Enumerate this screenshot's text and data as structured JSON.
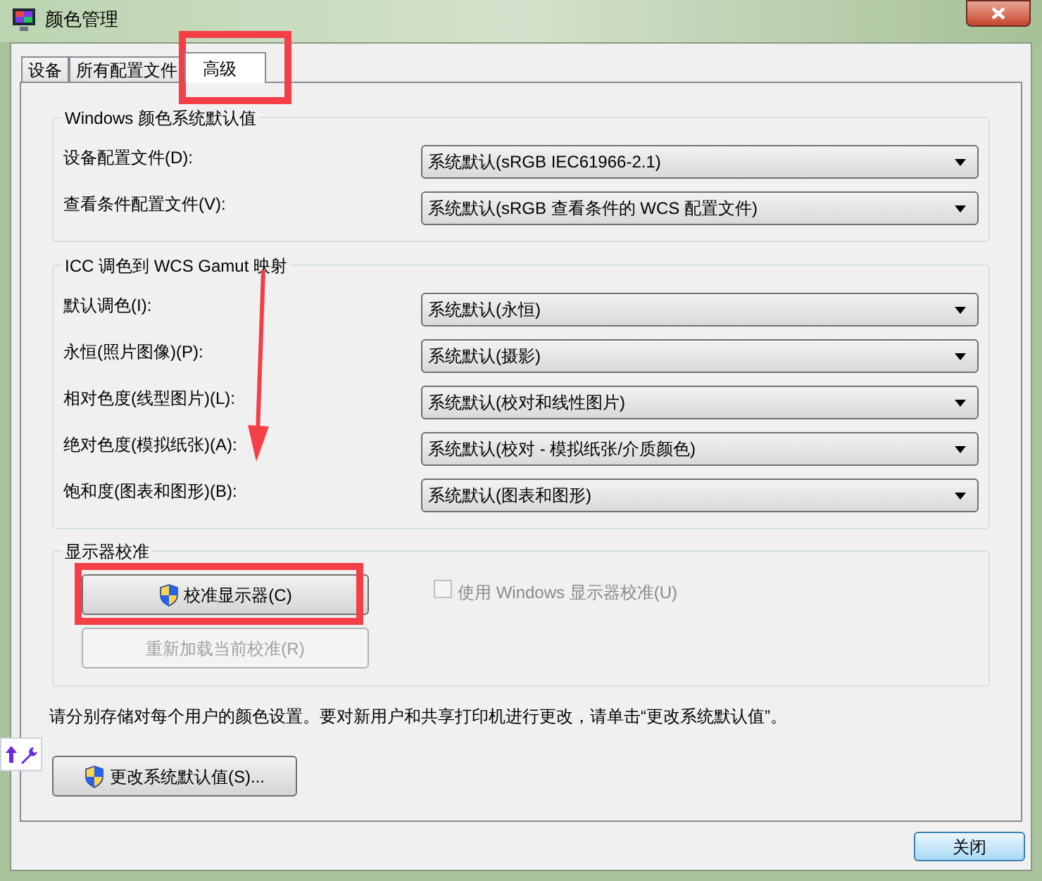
{
  "window": {
    "title": "颜色管理"
  },
  "tabs": [
    {
      "label": "设备",
      "selected": false
    },
    {
      "label": "所有配置文件",
      "selected": false
    },
    {
      "label": "高级",
      "selected": true
    }
  ],
  "groups": [
    {
      "title": "Windows 颜色系统默认值",
      "rows": [
        {
          "label": "设备配置文件(D):",
          "value": "系统默认(sRGB IEC61966-2.1)"
        },
        {
          "label": "查看条件配置文件(V):",
          "value": "系统默认(sRGB 查看条件的 WCS 配置文件)"
        }
      ]
    },
    {
      "title": "ICC 调色到 WCS Gamut 映射",
      "rows": [
        {
          "label": "默认调色(I):",
          "value": "系统默认(永恒)"
        },
        {
          "label": "永恒(照片图像)(P):",
          "value": "系统默认(摄影)"
        },
        {
          "label": "相对色度(线型图片)(L):",
          "value": "系统默认(校对和线性图片)"
        },
        {
          "label": "绝对色度(模拟纸张)(A):",
          "value": "系统默认(校对 - 模拟纸张/介质颜色)"
        },
        {
          "label": "饱和度(图表和图形)(B):",
          "value": "系统默认(图表和图形)"
        }
      ]
    }
  ],
  "calibration": {
    "title": "显示器校准",
    "calibrate_button": "校准显示器(C)",
    "reload_button": {
      "label": "重新加载当前校准(R)",
      "disabled": true
    },
    "use_windows": {
      "label": "使用 Windows 显示器校准(U)",
      "checked": false,
      "disabled": true
    }
  },
  "note": "请分别存储对每个用户的颜色设置。要对新用户和共享打印机进行更改，请单击“更改系统默认值”。",
  "change_defaults_button": "更改系统默认值(S)...",
  "close_button": "关闭"
}
